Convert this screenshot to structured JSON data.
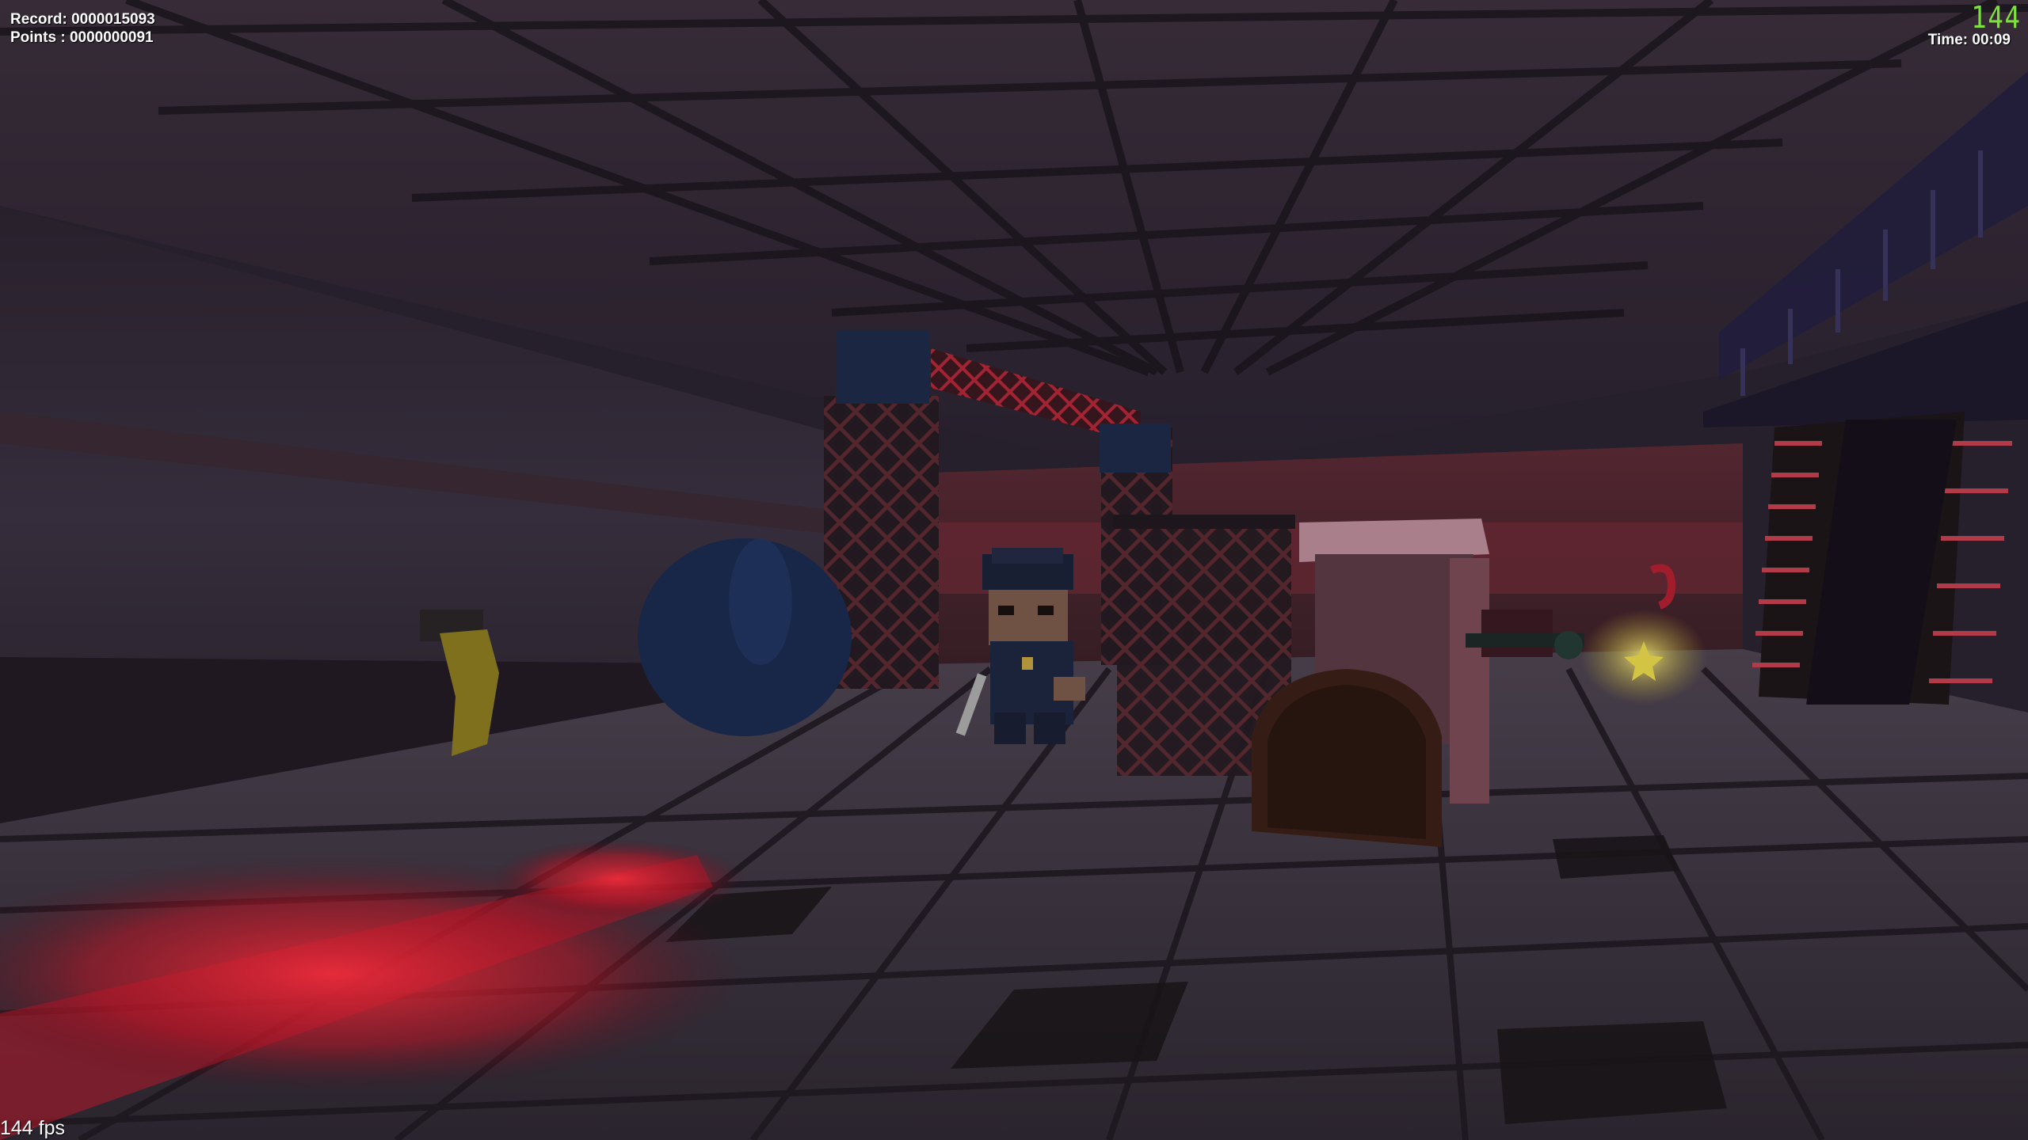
{
  "hud": {
    "record_label": "Record: 0000015093",
    "points_label": "Points : 0000000091",
    "timer_label": "Time: 00:09",
    "segment_counter": "144",
    "fps_label": "144 fps"
  },
  "scene": {
    "theme_colors": {
      "ceiling": "#3a2e3c",
      "wall": "#3d3340",
      "floor_tile": "#5f5664",
      "red_glow": "#ff2a3a",
      "police_blue": "#1e2a4a",
      "star_glow": "#e6d54a",
      "counter_green": "#7ee03a"
    }
  }
}
